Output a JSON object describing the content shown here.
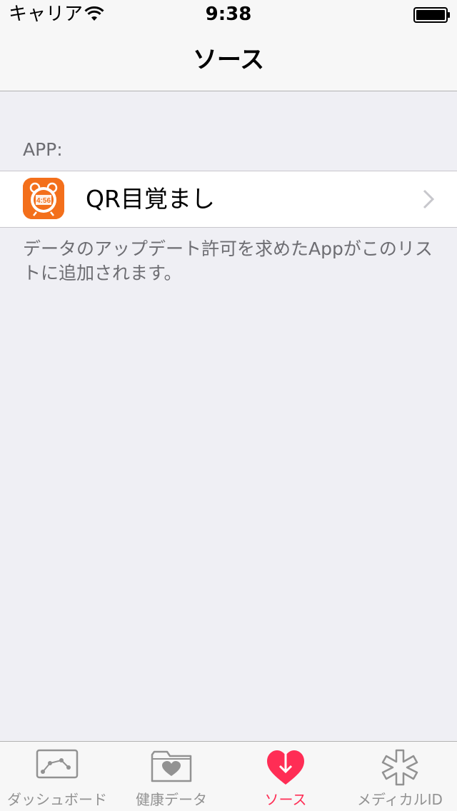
{
  "status_bar": {
    "carrier": "キャリア",
    "time": "9:38"
  },
  "nav": {
    "title": "ソース"
  },
  "section": {
    "header": "APP:",
    "items": [
      {
        "label": "QR目覚まし",
        "icon": "alarm-clock-app-icon"
      }
    ],
    "footer": "データのアップデート許可を求めたAppがこのリストに追加されます。"
  },
  "tabs": [
    {
      "label": "ダッシュボード",
      "icon": "dashboard-chart-icon",
      "active": false
    },
    {
      "label": "健康データ",
      "icon": "health-data-folder-icon",
      "active": false
    },
    {
      "label": "ソース",
      "icon": "sources-heart-icon",
      "active": true
    },
    {
      "label": "メディカルID",
      "icon": "medical-id-icon",
      "active": false
    }
  ],
  "colors": {
    "accent": "#ff2d55",
    "background": "#efeff4",
    "app_icon": "#f36f1b"
  }
}
